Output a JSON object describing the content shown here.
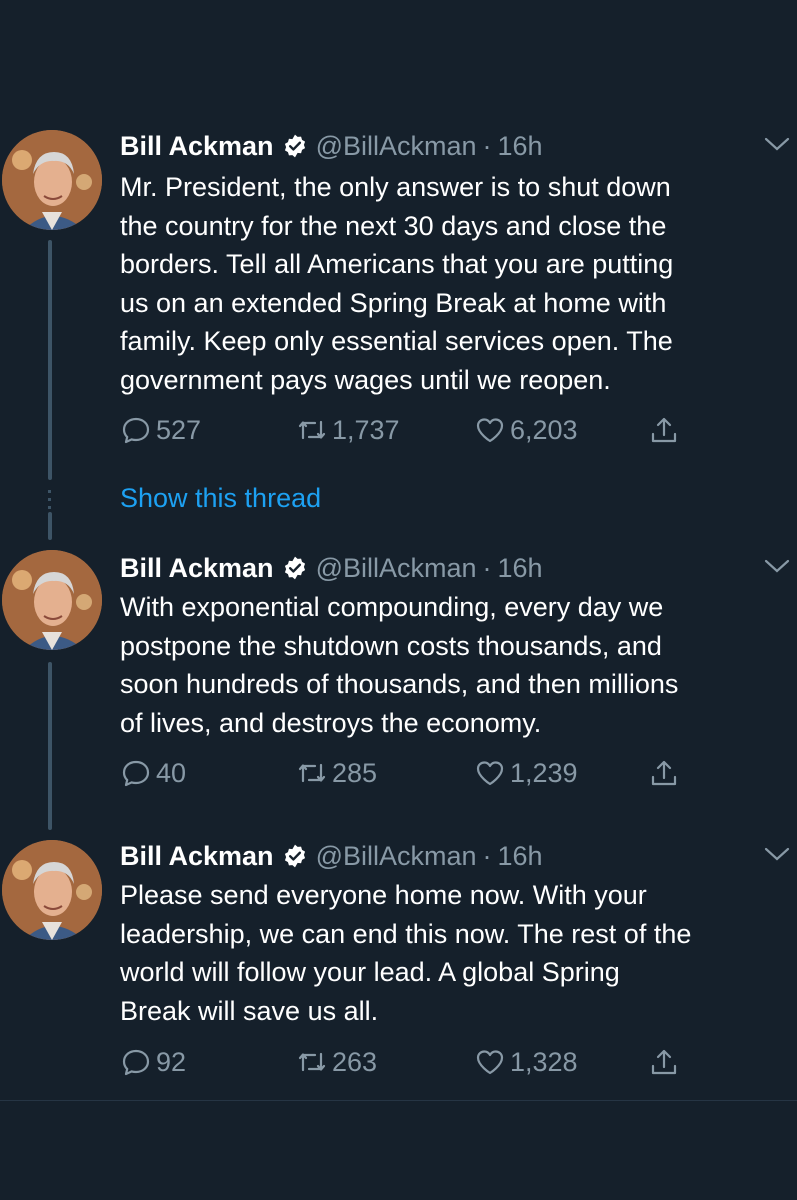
{
  "colors": {
    "background": "#15202b",
    "text_primary": "#ffffff",
    "text_secondary": "#8899a6",
    "link": "#1da1f2",
    "verified": "#ffffff",
    "thread_line": "#3d5466"
  },
  "show_thread_label": "Show this thread",
  "tweets": [
    {
      "name": "Bill Ackman",
      "handle": "@BillAckman",
      "separator": "·",
      "time": "16h",
      "text": "Mr. President, the only answer is to shut down\nthe country for the next 30 days and close the\nborders.  Tell all Americans that you are putting\nus on an extended Spring Break at home with\nfamily. Keep only essential services open. The\ngovernment pays wages until we reopen.",
      "replies": "527",
      "retweets": "1,737",
      "likes": "6,203"
    },
    {
      "name": "Bill Ackman",
      "handle": "@BillAckman",
      "separator": "·",
      "time": "16h",
      "text": "With exponential compounding, every day we\npostpone the shutdown costs thousands, and\nsoon hundreds of thousands, and then millions\nof lives, and destroys the economy.",
      "replies": "40",
      "retweets": "285",
      "likes": "1,239"
    },
    {
      "name": "Bill Ackman",
      "handle": "@BillAckman",
      "separator": "·",
      "time": "16h",
      "text": "Please send everyone home now. With your\nleadership, we can end this now. The rest of the\nworld will follow your lead.  A global Spring\nBreak will save us all.",
      "replies": "92",
      "retweets": "263",
      "likes": "1,328"
    }
  ],
  "icons": {
    "reply": "reply-icon",
    "retweet": "retweet-icon",
    "like": "heart-icon",
    "share": "share-icon",
    "verified": "verified-badge-icon",
    "menu": "chevron-down-icon"
  }
}
